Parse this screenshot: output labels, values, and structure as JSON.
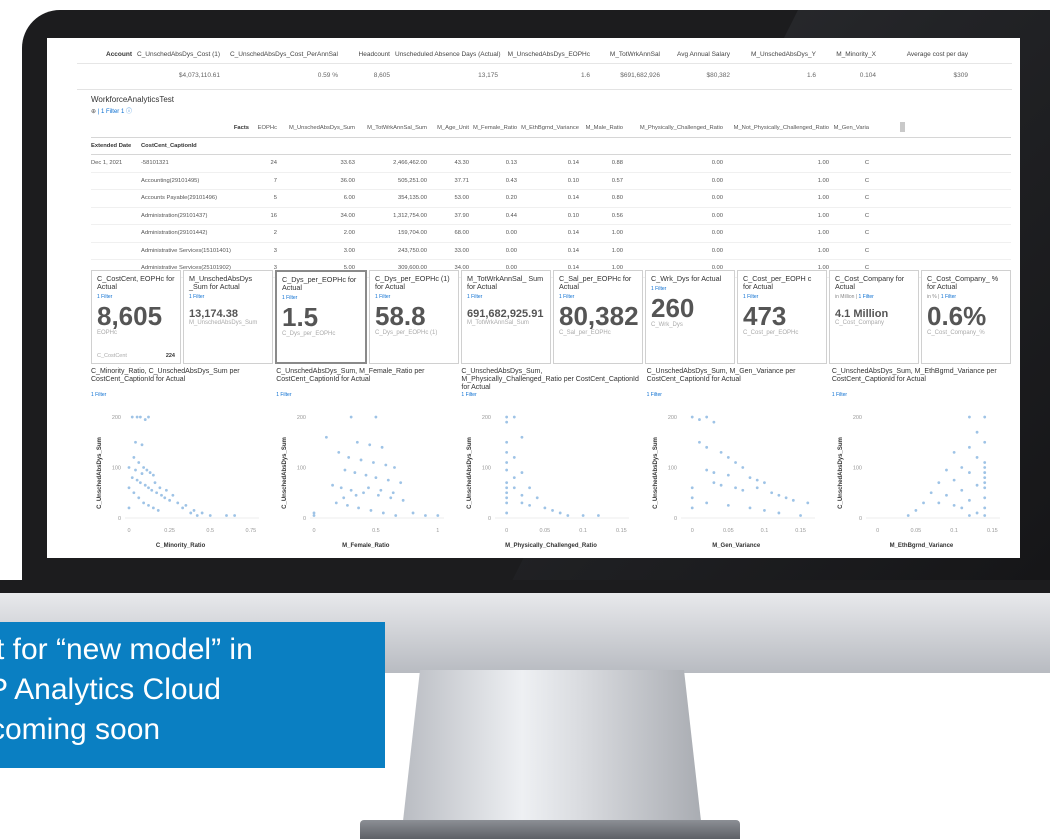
{
  "banner": {
    "line1": "rt for “new model” in",
    "line2": "P Analytics Cloud",
    "line3": "coming soon"
  },
  "kpi_header": {
    "columns": [
      "Account",
      "C_UnschedAbsDys_Cost (1)",
      "C_UnschedAbsDys_Cost_PerAnnSal",
      "Headcount",
      "Unscheduled Absence Days (Actual)",
      "M_UnschedAbsDys_EOPHc",
      "M_TotWrkAnnSal",
      "Avg Annual Salary",
      "M_UnschedAbsDys_Y",
      "M_Minority_X",
      "Average cost per day"
    ],
    "values": [
      "",
      "$4,073,110.61",
      "0.59 %",
      "8,605",
      "13,175",
      "1.6",
      "$691,682,926",
      "$80,382",
      "1.6",
      "0.104",
      "$309"
    ]
  },
  "table": {
    "title": "WorkforceAnalyticsTest",
    "filter_label": "1 Filter",
    "filter_extra": "1 ⓘ",
    "facts_label": "Facts",
    "columns": [
      "EOPHc",
      "M_UnschedAbsDys_Sum",
      "M_TotWrkAnnSal_Sum",
      "M_Age_Unit",
      "M_Female_Ratio",
      "M_EthBgrnd_Variance",
      "M_Male_Ratio",
      "M_Physically_Challenged_Ratio",
      "M_Not_Physically_Challenged_Ratio",
      "M_Gen_Varia"
    ],
    "dim1": "Extended Date",
    "dim2": "CostCent_CaptionId",
    "rows": [
      {
        "date": "Dec 1, 2021",
        "cc": "-58101321",
        "v": [
          "24",
          "33.63",
          "2,466,462.00",
          "43.30",
          "0.13",
          "0.14",
          "0.88",
          "0.00",
          "1.00",
          "C"
        ]
      },
      {
        "date": "",
        "cc": "Accounting(29101495)",
        "v": [
          "7",
          "36.00",
          "505,251.00",
          "37.71",
          "0.43",
          "0.10",
          "0.57",
          "0.00",
          "1.00",
          "C"
        ]
      },
      {
        "date": "",
        "cc": "Accounts Payable(29101496)",
        "v": [
          "5",
          "6.00",
          "354,135.00",
          "53.00",
          "0.20",
          "0.14",
          "0.80",
          "0.00",
          "1.00",
          "C"
        ]
      },
      {
        "date": "",
        "cc": "Administration(29101437)",
        "v": [
          "16",
          "34.00",
          "1,312,754.00",
          "37.90",
          "0.44",
          "0.10",
          "0.56",
          "0.00",
          "1.00",
          "C"
        ]
      },
      {
        "date": "",
        "cc": "Administration(29101442)",
        "v": [
          "2",
          "2.00",
          "159,704.00",
          "68.00",
          "0.00",
          "0.14",
          "1.00",
          "0.00",
          "1.00",
          "C"
        ]
      },
      {
        "date": "",
        "cc": "Administrative Services(15101401)",
        "v": [
          "3",
          "3.00",
          "243,750.00",
          "33.00",
          "0.00",
          "0.14",
          "1.00",
          "0.00",
          "1.00",
          "C"
        ]
      },
      {
        "date": "",
        "cc": "Administrative Services(25101902)",
        "v": [
          "3",
          "5.00",
          "309,600.00",
          "34.00",
          "0.00",
          "0.14",
          "1.00",
          "0.00",
          "1.00",
          "C"
        ]
      }
    ]
  },
  "tiles": [
    {
      "title": "C_CostCent, EOPHc for Actual",
      "filter": "1 Filter",
      "unit": "",
      "value": "8,605",
      "sub": "EOPHc",
      "foot_left": "C_CostCent",
      "foot_right": "224",
      "size": "big"
    },
    {
      "title": "M_UnschedAbsDys _Sum for Actual",
      "filter": "1 Filter",
      "unit": "",
      "value": "13,174.38",
      "sub": "M_UnschedAbsDys_Sum",
      "size": "mid"
    },
    {
      "title": "C_Dys_per_EOPHc for Actual",
      "filter": "1 Filter",
      "unit": "",
      "value": "1.5",
      "sub": "C_Dys_per_EOPHc",
      "size": "big"
    },
    {
      "title": "C_Dys_per_EOPHc (1) for Actual",
      "filter": "1 Filter",
      "unit": "",
      "value": "58.8",
      "sub": "C_Dys_per_EOPHc (1)",
      "size": "big"
    },
    {
      "title": "M_TotWrkAnnSal_ Sum for Actual",
      "filter": "1 Filter",
      "unit": "",
      "value": "691,682,925.91",
      "sub": "M_TotWrkAnnSal_Sum",
      "size": "mid"
    },
    {
      "title": "C_Sal_per_EOPHc for Actual",
      "filter": "1 Filter",
      "unit": "",
      "value": "80,382",
      "sub": "C_Sal_per_EOPHc",
      "size": "big"
    },
    {
      "title": "C_Wrk_Dys for Actual",
      "filter": "1 Filter",
      "unit": "",
      "value": "260",
      "sub": "C_Wrk_Dys",
      "size": "big"
    },
    {
      "title": "C_Cost_per_EOPH c for Actual",
      "filter": "1 Filter",
      "unit": "",
      "value": "473",
      "sub": "C_Cost_per_EOPHc",
      "size": "big"
    },
    {
      "title": "C_Cost_Company for Actual",
      "filter": "1 Filter",
      "unit": "in Million |",
      "value": "4.1 Million",
      "sub": "C_Cost_Company",
      "size": "mid"
    },
    {
      "title": "C_Cost_Company_ % for Actual",
      "filter": "1 Filter",
      "unit": "in % |",
      "value": "0.6%",
      "sub": "C_Cost_Company_%",
      "size": "big"
    }
  ],
  "chart_data": [
    {
      "type": "scatter",
      "title": "C_Minority_Ratio, C_UnschedAbsDys_Sum per CostCent_CaptionId for Actual",
      "filter": "1 Filter",
      "xlabel": "C_Minority_Ratio",
      "ylabel": "C_UnschedAbsDys_Sum",
      "xticks": [
        "0",
        "0.25",
        "0.5",
        "0.75"
      ],
      "yticks": [
        "0",
        "100",
        "200"
      ],
      "xlim": [
        0,
        0.8
      ],
      "ylim": [
        0,
        210
      ],
      "color": "#9ec3e6",
      "points": [
        [
          0.02,
          200
        ],
        [
          0.05,
          200
        ],
        [
          0.07,
          200
        ],
        [
          0.1,
          195
        ],
        [
          0.12,
          200
        ],
        [
          0.04,
          150
        ],
        [
          0.08,
          145
        ],
        [
          0.03,
          120
        ],
        [
          0.06,
          110
        ],
        [
          0.09,
          100
        ],
        [
          0.11,
          95
        ],
        [
          0.13,
          90
        ],
        [
          0.15,
          85
        ],
        [
          0.02,
          80
        ],
        [
          0.05,
          75
        ],
        [
          0.07,
          70
        ],
        [
          0.1,
          65
        ],
        [
          0.12,
          60
        ],
        [
          0.14,
          55
        ],
        [
          0.17,
          50
        ],
        [
          0.2,
          45
        ],
        [
          0.22,
          40
        ],
        [
          0.25,
          35
        ],
        [
          0.03,
          50
        ],
        [
          0.06,
          40
        ],
        [
          0.09,
          30
        ],
        [
          0.12,
          25
        ],
        [
          0.15,
          20
        ],
        [
          0.18,
          15
        ],
        [
          0.3,
          30
        ],
        [
          0.33,
          20
        ],
        [
          0.38,
          10
        ],
        [
          0.42,
          5
        ],
        [
          0.5,
          5
        ],
        [
          0.6,
          5
        ],
        [
          0.65,
          5
        ],
        [
          0.0,
          100
        ],
        [
          0.0,
          60
        ],
        [
          0.0,
          20
        ],
        [
          0.04,
          95
        ],
        [
          0.08,
          88
        ],
        [
          0.16,
          70
        ],
        [
          0.19,
          60
        ],
        [
          0.23,
          55
        ],
        [
          0.27,
          45
        ],
        [
          0.35,
          25
        ],
        [
          0.4,
          15
        ],
        [
          0.45,
          10
        ]
      ]
    },
    {
      "type": "scatter",
      "title": "C_UnschedAbsDys_Sum, M_Female_Ratio per CostCent_CaptionId for Actual",
      "filter": "1 Filter",
      "xlabel": "M_Female_Ratio",
      "ylabel": "C_UnschedAbsDys_Sum",
      "xticks": [
        "0",
        "0.5",
        "1"
      ],
      "yticks": [
        "0",
        "100",
        "200"
      ],
      "xlim": [
        0,
        1.05
      ],
      "ylim": [
        0,
        210
      ],
      "color": "#9ec3e6",
      "points": [
        [
          0.3,
          200
        ],
        [
          0.5,
          200
        ],
        [
          0.1,
          160
        ],
        [
          0.35,
          150
        ],
        [
          0.45,
          145
        ],
        [
          0.55,
          140
        ],
        [
          0.2,
          130
        ],
        [
          0.28,
          120
        ],
        [
          0.38,
          115
        ],
        [
          0.48,
          110
        ],
        [
          0.58,
          105
        ],
        [
          0.65,
          100
        ],
        [
          0.25,
          95
        ],
        [
          0.33,
          90
        ],
        [
          0.42,
          85
        ],
        [
          0.5,
          80
        ],
        [
          0.6,
          75
        ],
        [
          0.7,
          70
        ],
        [
          0.15,
          65
        ],
        [
          0.22,
          60
        ],
        [
          0.3,
          55
        ],
        [
          0.4,
          50
        ],
        [
          0.52,
          45
        ],
        [
          0.62,
          40
        ],
        [
          0.72,
          35
        ],
        [
          0.18,
          30
        ],
        [
          0.27,
          25
        ],
        [
          0.36,
          20
        ],
        [
          0.46,
          15
        ],
        [
          0.56,
          10
        ],
        [
          0.66,
          5
        ],
        [
          0.0,
          10
        ],
        [
          0.0,
          5
        ],
        [
          0.8,
          10
        ],
        [
          0.9,
          5
        ],
        [
          1.0,
          5
        ],
        [
          0.44,
          60
        ],
        [
          0.54,
          55
        ],
        [
          0.64,
          50
        ],
        [
          0.34,
          45
        ],
        [
          0.24,
          40
        ]
      ]
    },
    {
      "type": "scatter",
      "title": "C_UnschedAbsDys_Sum, M_Physically_Challenged_Ratio per CostCent_CaptionId for Actual",
      "filter": "1 Filter",
      "xlabel": "M_Physically_Challenged_Ratio",
      "ylabel": "C_UnschedAbsDys_Sum",
      "xticks": [
        "0",
        "0.05",
        "0.1",
        "0.15"
      ],
      "yticks": [
        "0",
        "100",
        "200"
      ],
      "xlim": [
        -0.01,
        0.16
      ],
      "ylim": [
        0,
        210
      ],
      "color": "#9ec3e6",
      "points": [
        [
          0.0,
          200
        ],
        [
          0.01,
          200
        ],
        [
          0.0,
          190
        ],
        [
          0.02,
          160
        ],
        [
          0.0,
          150
        ],
        [
          0.0,
          130
        ],
        [
          0.01,
          120
        ],
        [
          0.0,
          110
        ],
        [
          0.0,
          95
        ],
        [
          0.02,
          90
        ],
        [
          0.01,
          80
        ],
        [
          0.0,
          70
        ],
        [
          0.03,
          60
        ],
        [
          0.0,
          50
        ],
        [
          0.02,
          45
        ],
        [
          0.04,
          40
        ],
        [
          0.0,
          30
        ],
        [
          0.03,
          25
        ],
        [
          0.05,
          20
        ],
        [
          0.06,
          15
        ],
        [
          0.0,
          10
        ],
        [
          0.07,
          10
        ],
        [
          0.08,
          5
        ],
        [
          0.1,
          5
        ],
        [
          0.12,
          5
        ],
        [
          0.01,
          60
        ],
        [
          0.0,
          60
        ],
        [
          0.0,
          40
        ],
        [
          0.02,
          30
        ]
      ]
    },
    {
      "type": "scatter",
      "title": "C_UnschedAbsDys_Sum, M_Gen_Variance per CostCent_CaptionId for Actual",
      "filter": "1 Filter",
      "xlabel": "M_Gen_Variance",
      "ylabel": "C_UnschedAbsDys_Sum",
      "xticks": [
        "0",
        "0.05",
        "0.1",
        "0.15"
      ],
      "yticks": [
        "0",
        "100",
        "200"
      ],
      "xlim": [
        -0.01,
        0.17
      ],
      "ylim": [
        0,
        210
      ],
      "color": "#9ec3e6",
      "points": [
        [
          0.0,
          200
        ],
        [
          0.01,
          195
        ],
        [
          0.02,
          200
        ],
        [
          0.03,
          190
        ],
        [
          0.01,
          150
        ],
        [
          0.02,
          140
        ],
        [
          0.04,
          130
        ],
        [
          0.05,
          120
        ],
        [
          0.06,
          110
        ],
        [
          0.07,
          100
        ],
        [
          0.02,
          95
        ],
        [
          0.03,
          90
        ],
        [
          0.05,
          85
        ],
        [
          0.08,
          80
        ],
        [
          0.09,
          75
        ],
        [
          0.1,
          70
        ],
        [
          0.04,
          65
        ],
        [
          0.06,
          60
        ],
        [
          0.07,
          55
        ],
        [
          0.11,
          50
        ],
        [
          0.12,
          45
        ],
        [
          0.13,
          40
        ],
        [
          0.14,
          35
        ],
        [
          0.02,
          30
        ],
        [
          0.05,
          25
        ],
        [
          0.08,
          20
        ],
        [
          0.1,
          15
        ],
        [
          0.12,
          10
        ],
        [
          0.15,
          5
        ],
        [
          0.16,
          30
        ],
        [
          0.0,
          60
        ],
        [
          0.0,
          40
        ],
        [
          0.0,
          20
        ],
        [
          0.03,
          70
        ],
        [
          0.09,
          60
        ]
      ]
    },
    {
      "type": "scatter",
      "title": "C_UnschedAbsDys_Sum, M_EthBgrnd_Variance per CostCent_CaptionId for Actual",
      "filter": "1 Filter",
      "xlabel": "M_EthBgrnd_Variance",
      "ylabel": "C_UnschedAbsDys_Sum",
      "xticks": [
        "0",
        "0.05",
        "0.1",
        "0.15"
      ],
      "yticks": [
        "0",
        "100",
        "200"
      ],
      "xlim": [
        -0.01,
        0.16
      ],
      "ylim": [
        0,
        210
      ],
      "color": "#9ec3e6",
      "points": [
        [
          0.12,
          200
        ],
        [
          0.14,
          200
        ],
        [
          0.13,
          170
        ],
        [
          0.14,
          150
        ],
        [
          0.12,
          140
        ],
        [
          0.1,
          130
        ],
        [
          0.13,
          120
        ],
        [
          0.14,
          110
        ],
        [
          0.11,
          100
        ],
        [
          0.09,
          95
        ],
        [
          0.12,
          90
        ],
        [
          0.14,
          80
        ],
        [
          0.1,
          75
        ],
        [
          0.08,
          70
        ],
        [
          0.13,
          65
        ],
        [
          0.14,
          60
        ],
        [
          0.11,
          55
        ],
        [
          0.07,
          50
        ],
        [
          0.09,
          45
        ],
        [
          0.14,
          40
        ],
        [
          0.12,
          35
        ],
        [
          0.06,
          30
        ],
        [
          0.1,
          25
        ],
        [
          0.14,
          20
        ],
        [
          0.05,
          15
        ],
        [
          0.13,
          10
        ],
        [
          0.04,
          5
        ],
        [
          0.14,
          5
        ],
        [
          0.12,
          5
        ],
        [
          0.08,
          30
        ],
        [
          0.11,
          20
        ],
        [
          0.14,
          100
        ],
        [
          0.14,
          90
        ],
        [
          0.14,
          70
        ]
      ]
    }
  ]
}
